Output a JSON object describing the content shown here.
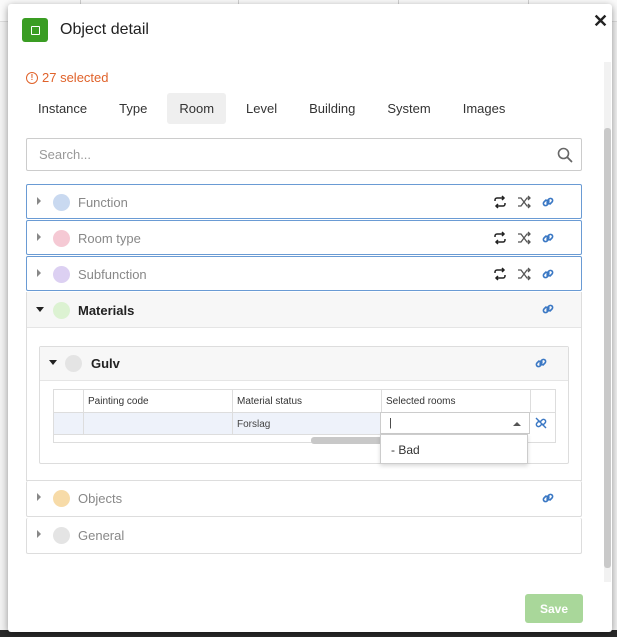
{
  "modal": {
    "title": "Object detail",
    "selected_text": "27 selected",
    "close_symbol": "✕"
  },
  "tabs": [
    {
      "label": "Instance",
      "active": false
    },
    {
      "label": "Type",
      "active": false
    },
    {
      "label": "Room",
      "active": true
    },
    {
      "label": "Level",
      "active": false
    },
    {
      "label": "Building",
      "active": false
    },
    {
      "label": "System",
      "active": false
    },
    {
      "label": "Images",
      "active": false
    }
  ],
  "search": {
    "placeholder": "Search..."
  },
  "groups": {
    "function": {
      "label": "Function",
      "color": "#c9d9f0"
    },
    "room_type": {
      "label": "Room type",
      "color": "#f5c9d4"
    },
    "subfunction": {
      "label": "Subfunction",
      "color": "#dcd0f2"
    },
    "materials": {
      "label": "Materials",
      "color": "#dcf2d2"
    },
    "gulv": {
      "label": "Gulv",
      "color": "#e4e4e4"
    },
    "objects": {
      "label": "Objects",
      "color": "#f7dba8"
    },
    "general": {
      "label": "General",
      "color": "#e4e4e4"
    }
  },
  "grid": {
    "columns": [
      "Painting code",
      "Material status",
      "Selected rooms"
    ],
    "row": {
      "painting_code": "",
      "material_status": "Forslag",
      "selected_rooms": "|"
    }
  },
  "dropdown": {
    "options": [
      "- Bad"
    ]
  },
  "footer": {
    "save_label": "Save"
  },
  "colors": {
    "accent_green": "#3a9d23",
    "warning": "#e0622a",
    "link_blue": "#3b78c4"
  }
}
